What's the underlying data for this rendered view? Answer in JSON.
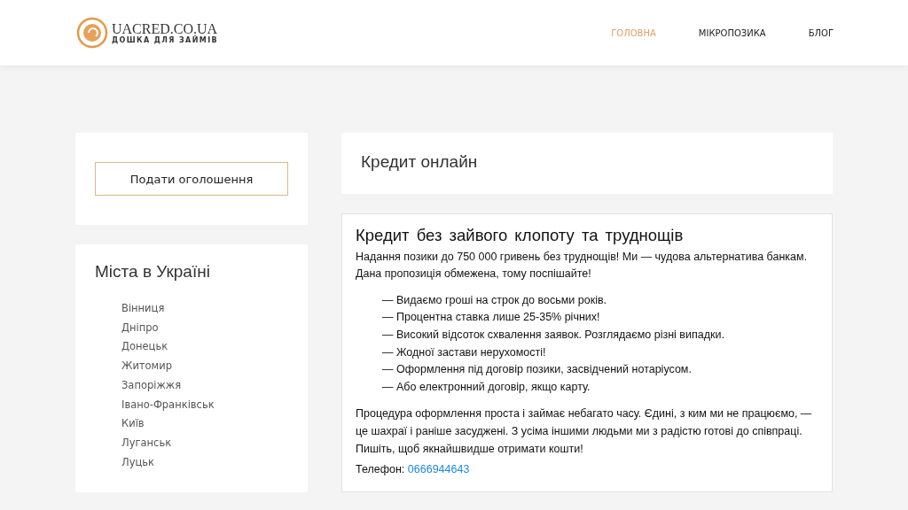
{
  "logo": {
    "title": "UACRED.CO.UA",
    "subtitle": "ДОШКА ДЛЯ ЗАЙМІВ"
  },
  "nav": [
    {
      "label": "ГОЛОВНА",
      "selected": true
    },
    {
      "label": "МІКРОПОЗИКА",
      "selected": false
    },
    {
      "label": "БЛОГ",
      "selected": false
    }
  ],
  "sidebar": {
    "button": "Подати оголошення",
    "cities_title": "Міста  в  Україні",
    "cities": [
      "Вінниця",
      "Дніпро",
      "Донецьк",
      "Житомир",
      "Запоріжжя",
      "Івано-Франківськ",
      "Київ",
      "Луганськ",
      "Луцьк"
    ]
  },
  "page_title": "Кредит  онлайн",
  "article": {
    "heading": "Кредит  без  зайвого  клопоту  та  труднощів",
    "intro": "Надання позики до 750 000 гривень без труднощів! Ми — чудова альтернатива банкам. Дана пропозиція обмежена, тому поспішайте!",
    "bullets": [
      "— Видаємо гроші на строк до восьми років.",
      "— Процентна ставка лише 25-35% річних!",
      "— Високий відсоток схвалення заявок. Розглядаємо різні випадки.",
      "— Жодної застави нерухомості!",
      "— Оформлення під договір позики, засвідчений нотаріусом.",
      "— Або електронний договір, якщо карту."
    ],
    "outro": "Процедура оформлення проста і займає небагато часу. Єдині, з ким ми не працюємо, — це шахраї і раніше засуджені. З усіма іншими людьми ми з радістю готові до співпраці. Пишіть, щоб якнайшвидше отримати кошти!",
    "phone_label": "Телефон:",
    "phone": "0666944643"
  }
}
